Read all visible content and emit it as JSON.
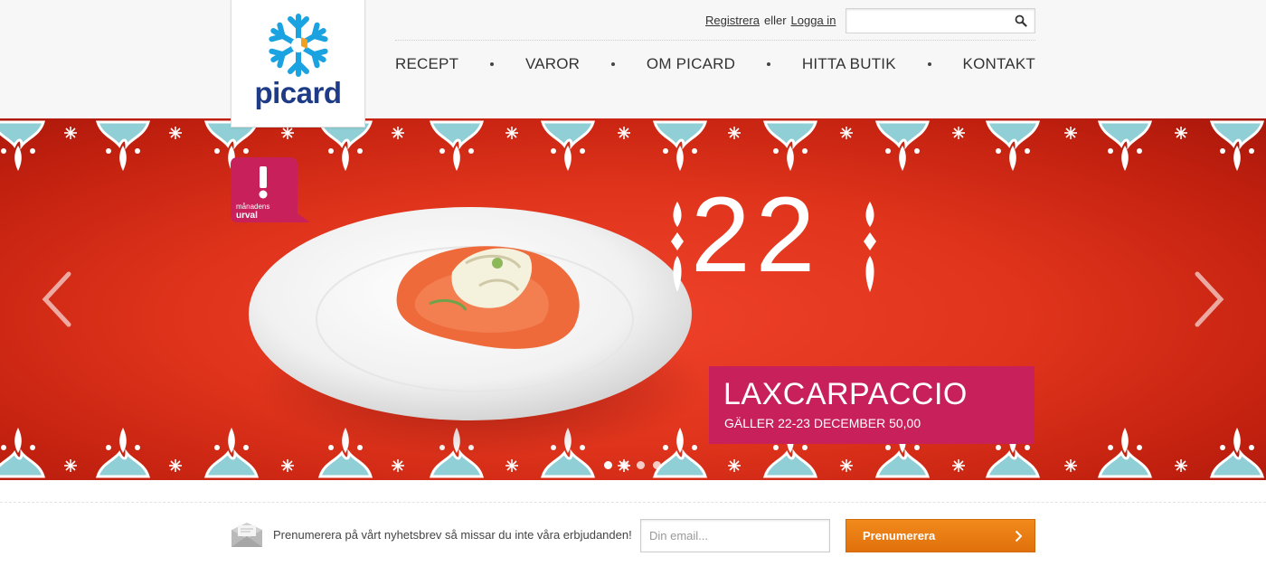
{
  "brand": {
    "name": "picard"
  },
  "auth": {
    "register": "Registrera",
    "separator": "eller",
    "login": "Logga in"
  },
  "search": {
    "placeholder": "",
    "icon": "search-icon"
  },
  "nav": {
    "items": [
      {
        "label": "RECEPT"
      },
      {
        "label": "VAROR"
      },
      {
        "label": "OM PICARD"
      },
      {
        "label": "HITTA BUTIK"
      },
      {
        "label": "KONTAKT"
      }
    ]
  },
  "hero": {
    "badge_line1": "månadens",
    "badge_line2": "urval",
    "day_number": "22",
    "promo_title": "LAXCARPACCIO",
    "promo_subtitle": "GÄLLER 22-23 DECEMBER 50,00",
    "slide_count": 4,
    "active_slide": 0,
    "colors": {
      "background": "#e0341c",
      "promo": "#c8205a",
      "pattern_blue": "#8fcfd5"
    }
  },
  "newsletter": {
    "text": "Prenumerera på vårt nyhetsbrev så missar du inte våra erbjudanden!",
    "email_placeholder": "Din email...",
    "button_label": "Prenumerera",
    "button_color": "#ec7d14"
  }
}
